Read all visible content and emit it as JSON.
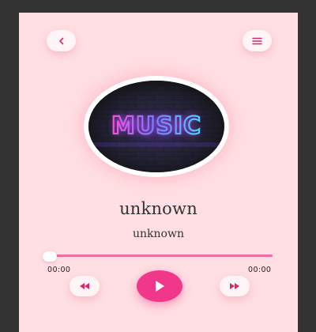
{
  "colors": {
    "background": "#ffdfe3",
    "outer": "#333333",
    "accent": "#f0378a",
    "accent_dark": "#e0307f",
    "button_bg": "#fff4f6"
  },
  "header": {
    "back_icon": "chevron-left-icon",
    "menu_icon": "hamburger-menu-icon"
  },
  "album": {
    "art_text": "MUSIC"
  },
  "track": {
    "title": "unknown",
    "artist": "unknown"
  },
  "progress": {
    "current_time": "00:00",
    "total_time": "00:00",
    "fraction": 0
  },
  "controls": {
    "prev_icon": "rewind-icon",
    "play_icon": "play-icon",
    "next_icon": "fast-forward-icon"
  }
}
